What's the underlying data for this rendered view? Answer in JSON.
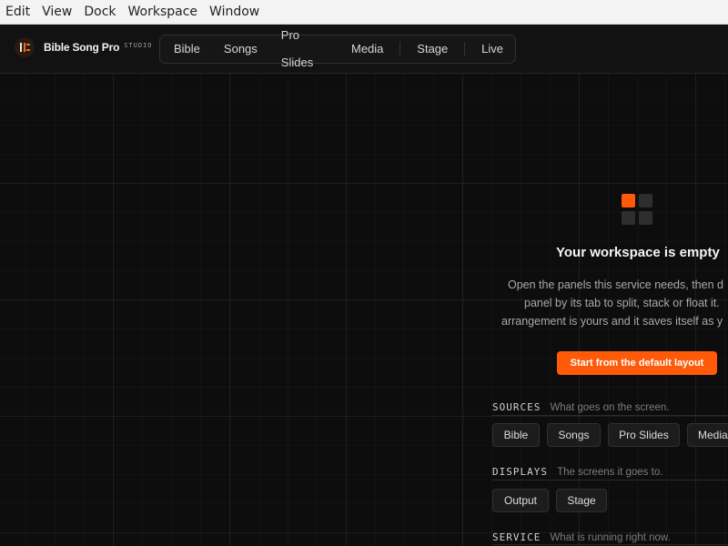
{
  "menubar": {
    "items": [
      "Edit",
      "View",
      "Dock",
      "Workspace",
      "Window"
    ]
  },
  "app": {
    "brand_name": "Bible Song Pro",
    "brand_sub": "STUDIO"
  },
  "nav": {
    "tabs": [
      "Bible",
      "Songs",
      "Pro Slides",
      "Media",
      "Stage",
      "Live"
    ]
  },
  "empty_state": {
    "title": "Your workspace is empty",
    "description_lines": [
      "Open the panels this service needs, then d",
      "panel by its tab to split, stack or float it.",
      "arrangement is yours and it saves itself as y"
    ],
    "cta_label": "Start from the default layout"
  },
  "sections": {
    "sources": {
      "label": "SOURCES",
      "hint": "What goes on the screen.",
      "chips": [
        "Bible",
        "Songs",
        "Pro Slides",
        "Media"
      ]
    },
    "displays": {
      "label": "DISPLAYS",
      "hint": "The screens it goes to.",
      "chips": [
        "Output",
        "Stage"
      ]
    },
    "service": {
      "label": "SERVICE",
      "hint": "What is running right now."
    }
  },
  "colors": {
    "accent": "#ff5a0a",
    "background": "#0e0e0e",
    "menubar": "#f3f3f3"
  }
}
